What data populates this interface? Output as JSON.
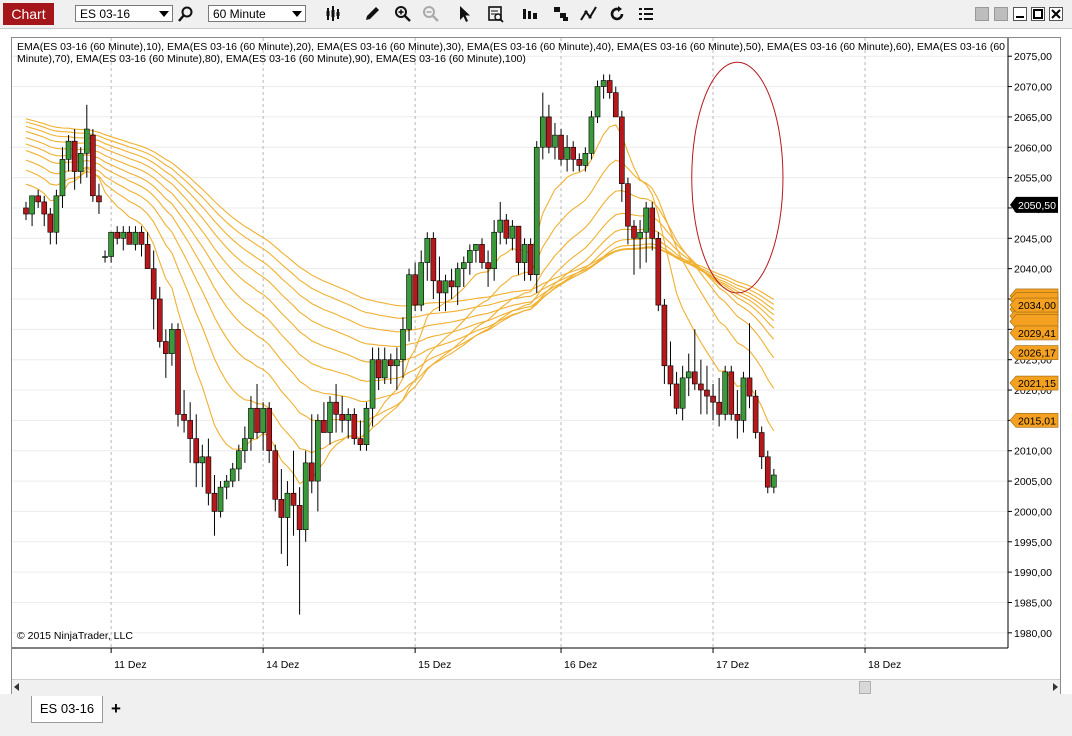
{
  "toolbar": {
    "chart_label": "Chart",
    "instrument": "ES 03-16",
    "interval": "60 Minute"
  },
  "indicator_legend": "EMA(ES 03-16 (60 Minute),10), EMA(ES 03-16 (60 Minute),20), EMA(ES 03-16 (60 Minute),30), EMA(ES 03-16 (60 Minute),40), EMA(ES 03-16 (60 Minute),50), EMA(ES 03-16 (60 Minute),60), EMA(ES 03-16 (60 Minute),70), EMA(ES 03-16 (60 Minute),80), EMA(ES 03-16 (60 Minute),90), EMA(ES 03-16 (60 Minute),100)",
  "copyright": "© 2015 NinjaTrader, LLC",
  "tabs": {
    "instrument": "ES 03-16",
    "add": "+"
  },
  "colors": {
    "up": "#3a9a3a",
    "down": "#b5191c",
    "ema": "#f0b030",
    "price_tag": "#000000",
    "ema_tag": "#f4a021",
    "annotation": "#b5191c",
    "chart_tab": "#a4161a"
  },
  "chart_data": {
    "type": "candlestick",
    "ylim": [
      1977.5,
      2078
    ],
    "y_ticks": [
      "1980,00",
      "1985,00",
      "1990,00",
      "1995,00",
      "2000,00",
      "2005,00",
      "2010,00",
      "2015,00",
      "2020,00",
      "2025,00",
      "2030,00",
      "2035,00",
      "2040,00",
      "2045,00",
      "2050,00",
      "2055,00",
      "2060,00",
      "2065,00",
      "2070,00",
      "2075,00"
    ],
    "y_tick_values": [
      1980,
      1985,
      1990,
      1995,
      2000,
      2005,
      2010,
      2015,
      2020,
      2025,
      2030,
      2035,
      2040,
      2045,
      2050,
      2055,
      2060,
      2065,
      2070,
      2075
    ],
    "x_labels": [
      {
        "label": "11 Dez",
        "bar": 14
      },
      {
        "label": "14 Dez",
        "bar": 39
      },
      {
        "label": "15 Dez",
        "bar": 64
      },
      {
        "label": "16 Dez",
        "bar": 88
      },
      {
        "label": "17 Dez",
        "bar": 113
      },
      {
        "label": "18 Dez",
        "bar": 138
      }
    ],
    "last_price": "2050,50",
    "last_price_value": 2050.5,
    "ema_tags": [
      {
        "label": "2034,00",
        "value": 2034.0
      },
      {
        "label": "2029,41",
        "value": 2029.41
      },
      {
        "label": "2026,17",
        "value": 2026.17
      },
      {
        "label": "2021,15",
        "value": 2021.15
      },
      {
        "label": "2015,01",
        "value": 2015.01
      }
    ],
    "ema_periods": [
      10,
      20,
      30,
      40,
      50,
      60,
      70,
      80,
      90,
      100
    ],
    "ema_start": [
      2055,
      2057,
      2058.5,
      2060,
      2061,
      2062,
      2063,
      2063.8,
      2064.5,
      2065
    ],
    "annotation": {
      "type": "ellipse",
      "bar_center": 117,
      "y_center": 2055,
      "bar_rx": 7.5,
      "y_ry": 19
    },
    "candles": [
      [
        2050,
        2051,
        2048,
        2049
      ],
      [
        2049,
        2052,
        2047,
        2052
      ],
      [
        2052,
        2053,
        2050,
        2051
      ],
      [
        2051,
        2052,
        2047,
        2049
      ],
      [
        2049,
        2050,
        2044,
        2046
      ],
      [
        2046,
        2053,
        2044,
        2052
      ],
      [
        2052,
        2060,
        2050,
        2058
      ],
      [
        2058,
        2062,
        2056,
        2061
      ],
      [
        2061,
        2063,
        2053,
        2056
      ],
      [
        2056,
        2060,
        2054,
        2059
      ],
      [
        2059,
        2067,
        2055,
        2063
      ],
      [
        2062,
        2063,
        2051,
        2052
      ],
      [
        2052,
        2054,
        2049,
        2051
      ],
      [
        2042,
        2043,
        2041,
        2042
      ],
      [
        2042,
        2046,
        2041,
        2046
      ],
      [
        2046,
        2047,
        2044,
        2045
      ],
      [
        2045,
        2047,
        2043,
        2046
      ],
      [
        2046,
        2047,
        2044,
        2044
      ],
      [
        2044,
        2047,
        2043,
        2046
      ],
      [
        2046,
        2047,
        2042,
        2044
      ],
      [
        2044,
        2046,
        2040,
        2040
      ],
      [
        2040,
        2043,
        2030,
        2035
      ],
      [
        2035,
        2037,
        2027,
        2028
      ],
      [
        2028,
        2030,
        2022,
        2026
      ],
      [
        2026,
        2031,
        2024,
        2030
      ],
      [
        2030,
        2031,
        2014,
        2016
      ],
      [
        2016,
        2020,
        2013,
        2015
      ],
      [
        2015,
        2018,
        2008,
        2012
      ],
      [
        2012,
        2016,
        2004,
        2008
      ],
      [
        2008,
        2011,
        2004,
        2009
      ],
      [
        2009,
        2012,
        2001,
        2003
      ],
      [
        2003,
        2006,
        1996,
        2000
      ],
      [
        2000,
        2005,
        1999,
        2004
      ],
      [
        2004,
        2006,
        2002,
        2005
      ],
      [
        2005,
        2008,
        2004,
        2007
      ],
      [
        2007,
        2011,
        2005,
        2010
      ],
      [
        2010,
        2014,
        2008,
        2012
      ],
      [
        2012,
        2019,
        2010,
        2017
      ],
      [
        2017,
        2021,
        2012,
        2013
      ],
      [
        2013,
        2018,
        2010,
        2017
      ],
      [
        2017,
        2018,
        2008,
        2010
      ],
      [
        2010,
        2011,
        2000,
        2002
      ],
      [
        2002,
        2007,
        1993,
        1999
      ],
      [
        1999,
        2005,
        1991,
        2003
      ],
      [
        2003,
        2010,
        1996,
        2001
      ],
      [
        2001,
        2004,
        1983,
        1997
      ],
      [
        1997,
        2010,
        1995,
        2008
      ],
      [
        2008,
        2016,
        2003,
        2005
      ],
      [
        2005,
        2016,
        2000,
        2015
      ],
      [
        2015,
        2018,
        2013,
        2013
      ],
      [
        2013,
        2019,
        2011,
        2018
      ],
      [
        2018,
        2021,
        2013,
        2016
      ],
      [
        2016,
        2019,
        2013,
        2015
      ],
      [
        2015,
        2017,
        2012,
        2016
      ],
      [
        2016,
        2017,
        2011,
        2012
      ],
      [
        2012,
        2015,
        2010,
        2011
      ],
      [
        2011,
        2018,
        2010,
        2017
      ],
      [
        2017,
        2027,
        2014,
        2025
      ],
      [
        2025,
        2027,
        2020,
        2022
      ],
      [
        2022,
        2027,
        2021,
        2025
      ],
      [
        2025,
        2026,
        2021,
        2024
      ],
      [
        2024,
        2027,
        2020,
        2025
      ],
      [
        2025,
        2032,
        2022,
        2030
      ],
      [
        2030,
        2040,
        2028,
        2039
      ],
      [
        2039,
        2041,
        2033,
        2034
      ],
      [
        2034,
        2043,
        2033,
        2041
      ],
      [
        2041,
        2046,
        2038,
        2045
      ],
      [
        2045,
        2046,
        2035,
        2038
      ],
      [
        2038,
        2042,
        2033,
        2036
      ],
      [
        2036,
        2039,
        2033,
        2038
      ],
      [
        2038,
        2040,
        2035,
        2037
      ],
      [
        2037,
        2041,
        2034,
        2040
      ],
      [
        2040,
        2042,
        2037,
        2041
      ],
      [
        2041,
        2044,
        2039,
        2043
      ],
      [
        2043,
        2044,
        2041,
        2044
      ],
      [
        2044,
        2045,
        2040,
        2041
      ],
      [
        2041,
        2043,
        2037,
        2040
      ],
      [
        2040,
        2048,
        2038,
        2046
      ],
      [
        2046,
        2051,
        2044,
        2048
      ],
      [
        2048,
        2049,
        2044,
        2045
      ],
      [
        2045,
        2048,
        2043,
        2047
      ],
      [
        2047,
        2047,
        2039,
        2041
      ],
      [
        2041,
        2045,
        2038,
        2044
      ],
      [
        2044,
        2045,
        2038,
        2039
      ],
      [
        2039,
        2061,
        2036,
        2060
      ],
      [
        2060,
        2069,
        2058,
        2065
      ],
      [
        2065,
        2067,
        2059,
        2060
      ],
      [
        2060,
        2064,
        2058,
        2062
      ],
      [
        2062,
        2063,
        2057,
        2058
      ],
      [
        2058,
        2062,
        2056,
        2060
      ],
      [
        2060,
        2061,
        2056,
        2058
      ],
      [
        2058,
        2059,
        2056,
        2057
      ],
      [
        2057,
        2060,
        2056,
        2059
      ],
      [
        2059,
        2066,
        2058,
        2065
      ],
      [
        2065,
        2071,
        2064,
        2070
      ],
      [
        2070,
        2072,
        2068,
        2071
      ],
      [
        2071,
        2072,
        2068,
        2069
      ],
      [
        2069,
        2070,
        2065,
        2065
      ],
      [
        2065,
        2066,
        2051,
        2054
      ],
      [
        2054,
        2055,
        2044,
        2047
      ],
      [
        2047,
        2048,
        2039,
        2045
      ],
      [
        2045,
        2048,
        2040,
        2046
      ],
      [
        2046,
        2051,
        2041,
        2050
      ],
      [
        2050,
        2051,
        2043,
        2045
      ],
      [
        2045,
        2046,
        2033,
        2034
      ],
      [
        2034,
        2035,
        2021,
        2024
      ],
      [
        2024,
        2028,
        2019,
        2021
      ],
      [
        2021,
        2023,
        2016,
        2017
      ],
      [
        2017,
        2024,
        2015,
        2022
      ],
      [
        2022,
        2026,
        2019,
        2023
      ],
      [
        2023,
        2030,
        2020,
        2021
      ],
      [
        2021,
        2025,
        2016,
        2020
      ],
      [
        2020,
        2024,
        2016,
        2019
      ],
      [
        2019,
        2021,
        2015,
        2018
      ],
      [
        2018,
        2022,
        2014,
        2016
      ],
      [
        2016,
        2024,
        2015,
        2023
      ],
      [
        2023,
        2024,
        2015,
        2016
      ],
      [
        2016,
        2020,
        2012,
        2015
      ],
      [
        2015,
        2023,
        2013,
        2022
      ],
      [
        2022,
        2031,
        2017,
        2019
      ],
      [
        2019,
        2020,
        2012,
        2013
      ],
      [
        2013,
        2014,
        2007,
        2009
      ],
      [
        2009,
        2010,
        2003,
        2004
      ],
      [
        2004,
        2007,
        2003,
        2006
      ]
    ]
  }
}
